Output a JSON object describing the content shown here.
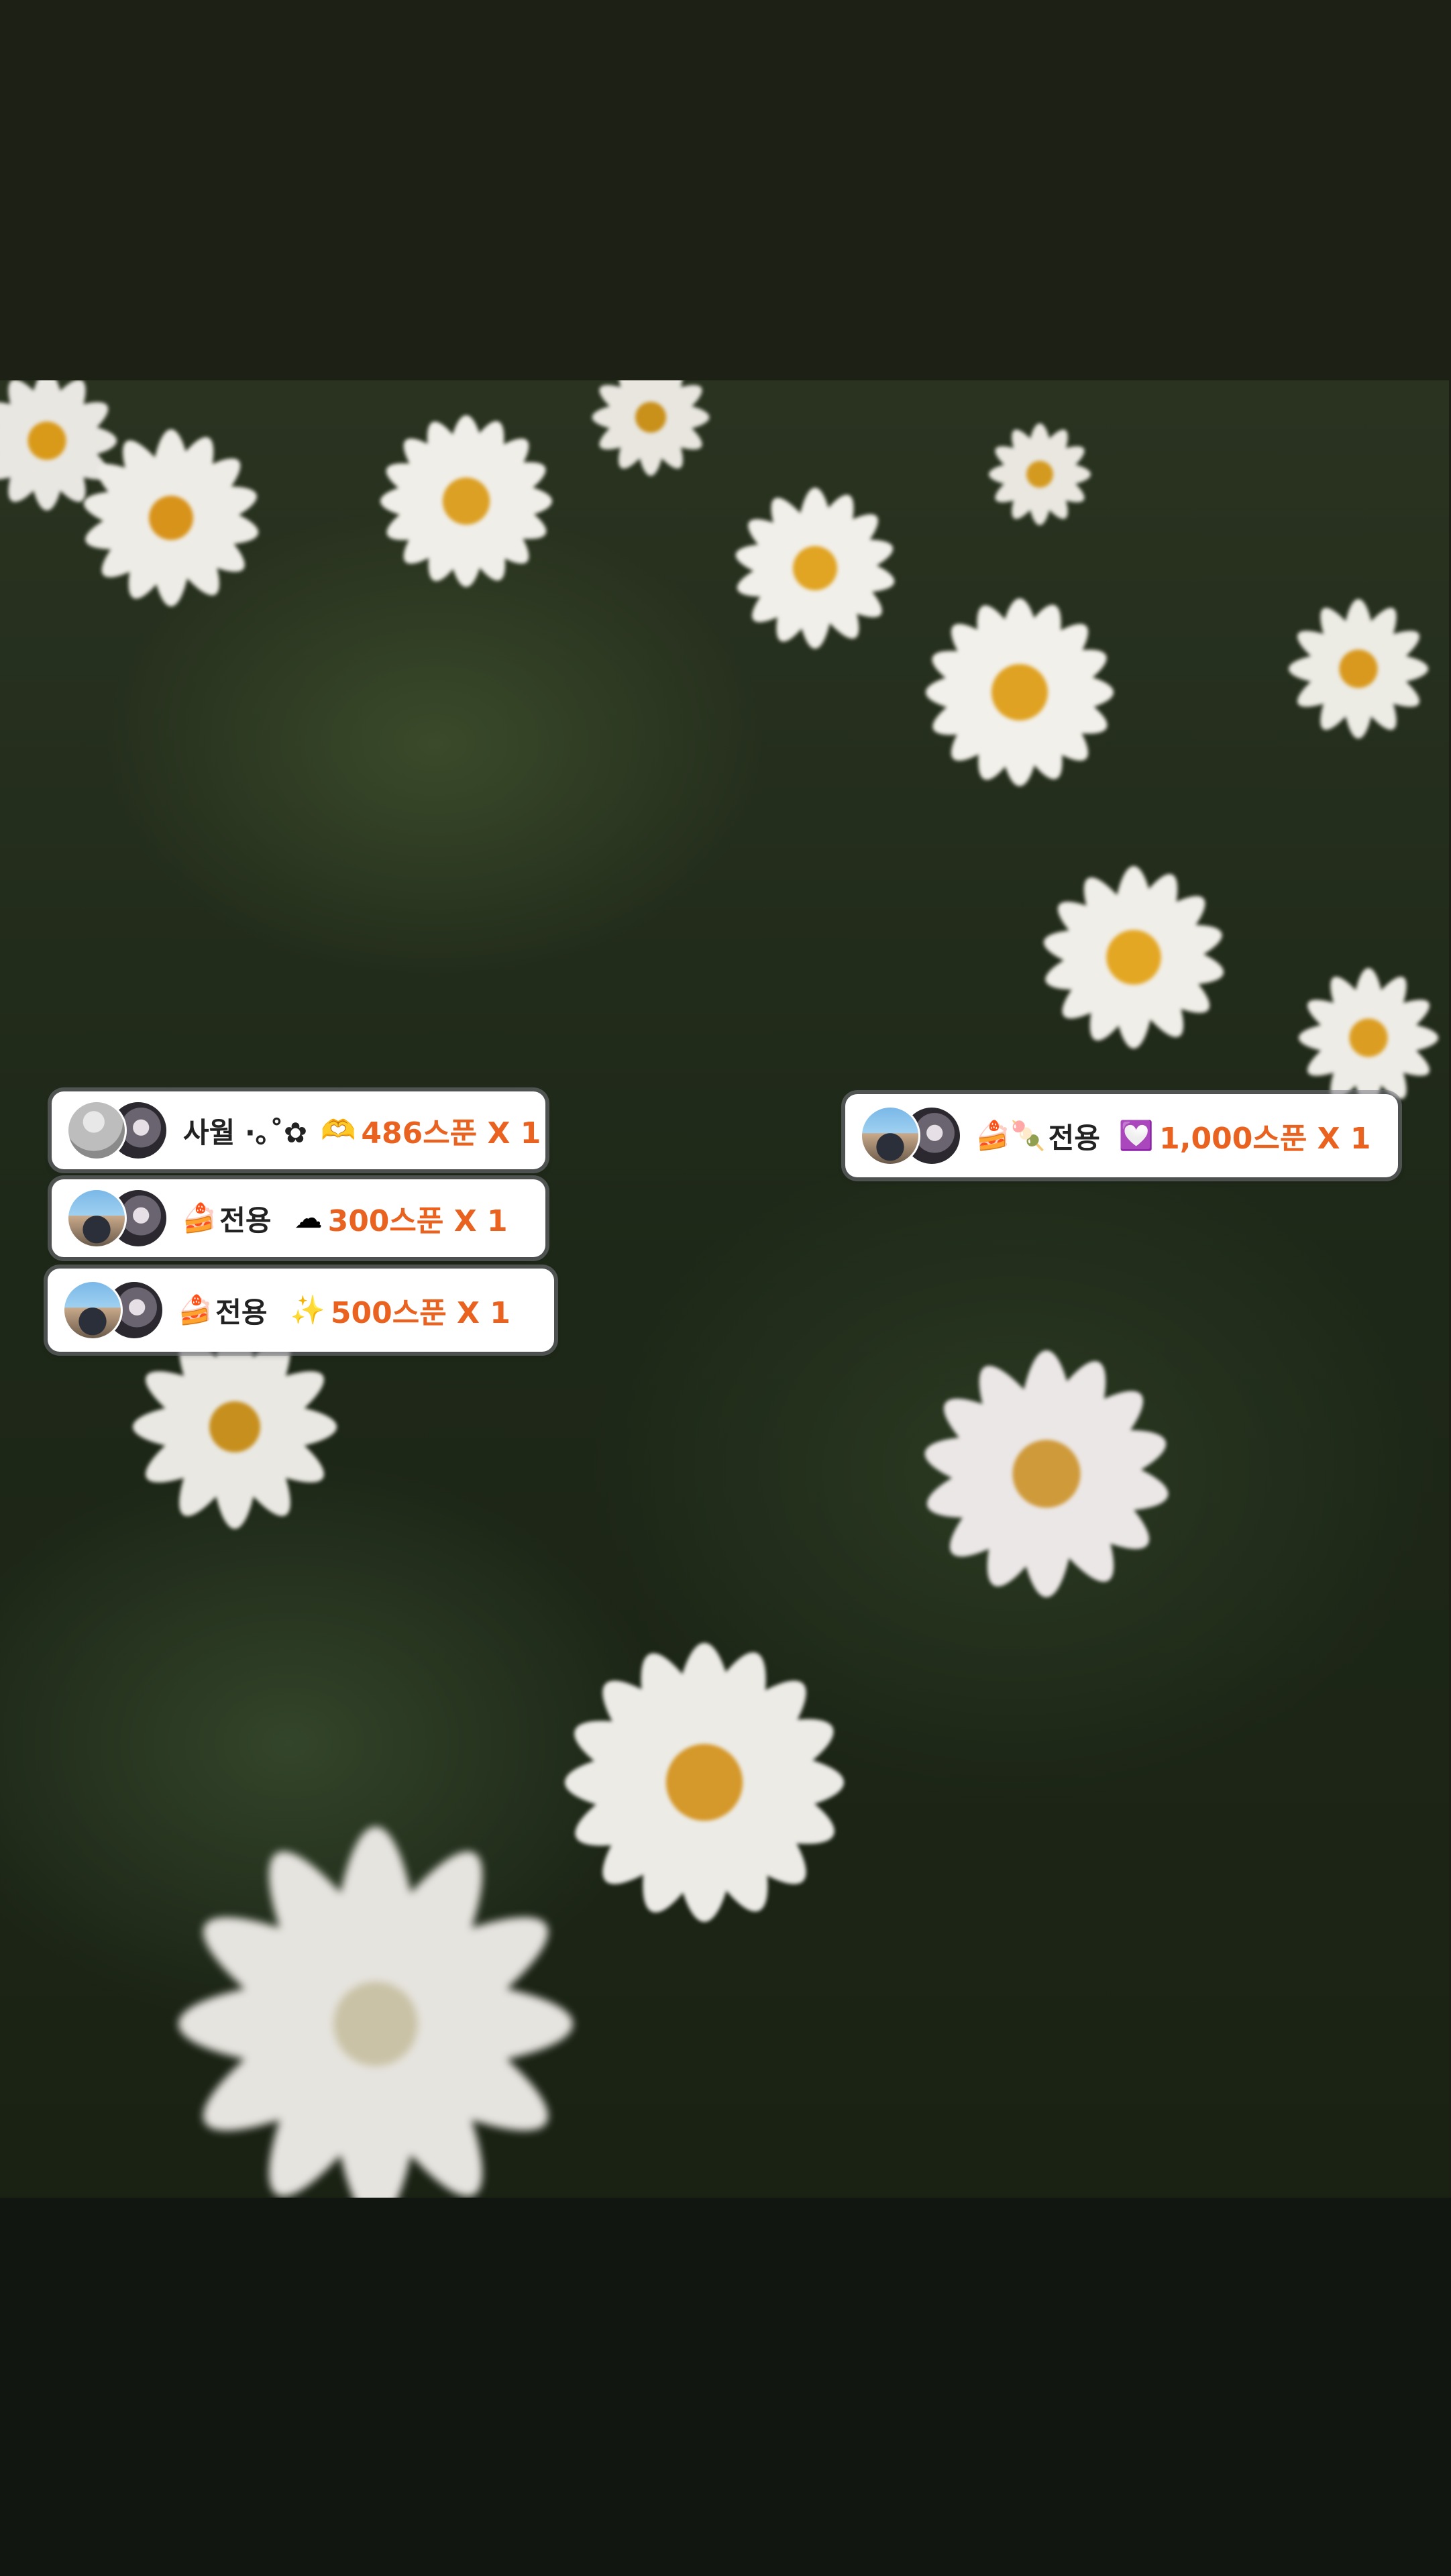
{
  "gifts": [
    {
      "name": "사월 ·｡˚✿",
      "prefix_emoji": "",
      "gift_emoji": "🫶",
      "amount": "486스푼 X 1"
    },
    {
      "name": "전용",
      "prefix_emoji": "🍰",
      "gift_emoji": "☁",
      "amount": "300스푼 X 1"
    },
    {
      "name": "전용",
      "prefix_emoji": "🍰",
      "gift_emoji": "✨",
      "amount": "500스푼 X 1"
    },
    {
      "name": "전용",
      "prefix_emoji": "🍰🍡",
      "gift_emoji": "💟",
      "amount": "1,000스푼 X 1"
    }
  ],
  "colors": {
    "amount": "#e9621f",
    "name": "#222222",
    "card": "#ffffff"
  },
  "icons": [
    "user-avatar",
    "cake-icon",
    "dango-icon",
    "heart-icon",
    "cloud-icon",
    "sparkle-icon",
    "hands-heart-icon"
  ]
}
